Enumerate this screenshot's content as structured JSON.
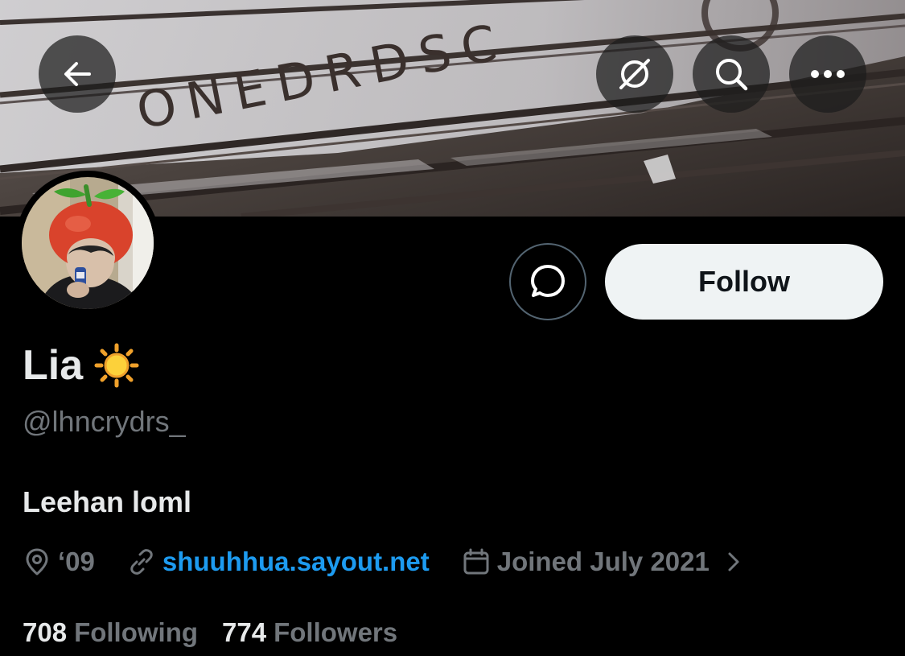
{
  "colors": {
    "background": "#000000",
    "primary_text": "#e7e9ea",
    "secondary_text": "#71767b",
    "link": "#1d9bf0",
    "follow_button_bg": "#eff3f4",
    "follow_button_text": "#0f1419",
    "border": "#536471"
  },
  "banner": {
    "snow_text": "ONEDRDSC"
  },
  "top_bar": {
    "back_icon": "arrow-left-icon",
    "grok_icon": "grok-slash-icon",
    "search_icon": "search-icon",
    "more_icon": "more-dots-icon"
  },
  "profile": {
    "display_name": "Lia",
    "name_emoji": "sun-emoji",
    "handle": "@lhncrydrs_",
    "bio": "Leehan loml",
    "location": "‘09",
    "website": "shuuhhua.sayout.net",
    "joined": "Joined July 2021"
  },
  "actions": {
    "message_icon": "message-bubble-icon",
    "follow_label": "Follow"
  },
  "stats": {
    "following_count": "708",
    "following_label": "Following",
    "followers_count": "774",
    "followers_label": "Followers"
  }
}
